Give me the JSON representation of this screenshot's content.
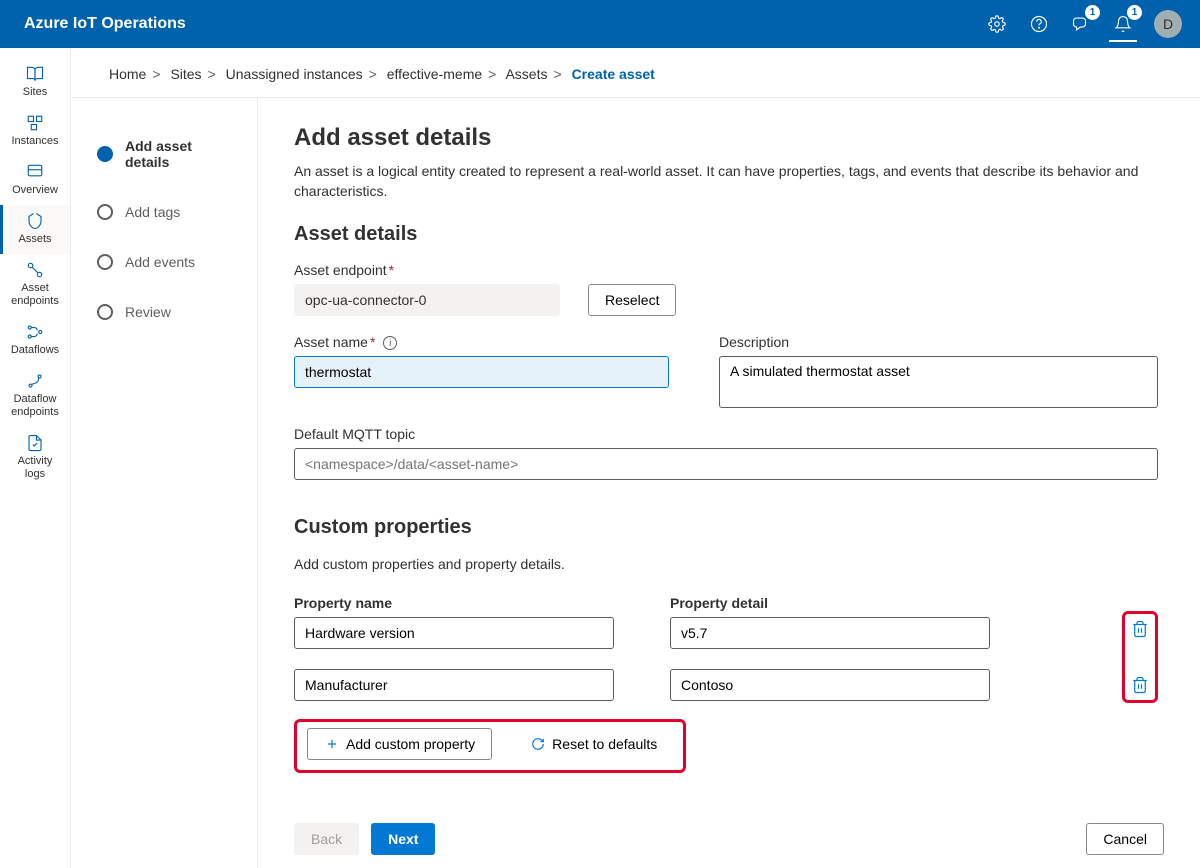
{
  "header": {
    "title": "Azure IoT Operations",
    "badge1": "1",
    "badge2": "1",
    "avatar": "D"
  },
  "sidebar": {
    "items": [
      {
        "label": "Sites"
      },
      {
        "label": "Instances"
      },
      {
        "label": "Overview"
      },
      {
        "label": "Assets"
      },
      {
        "label": "Asset endpoints"
      },
      {
        "label": "Dataflows"
      },
      {
        "label": "Dataflow endpoints"
      },
      {
        "label": "Activity logs"
      }
    ]
  },
  "breadcrumb": {
    "items": [
      "Home",
      "Sites",
      "Unassigned instances",
      "effective-meme",
      "Assets"
    ],
    "current": "Create asset"
  },
  "steps": [
    {
      "label": "Add asset details",
      "state": "current"
    },
    {
      "label": "Add tags",
      "state": "future"
    },
    {
      "label": "Add events",
      "state": "future"
    },
    {
      "label": "Review",
      "state": "future"
    }
  ],
  "form": {
    "title": "Add asset details",
    "desc": "An asset is a logical entity created to represent a real-world asset. It can have properties, tags, and events that describe its behavior and characteristics.",
    "section1": "Asset details",
    "asset_endpoint_label": "Asset endpoint",
    "asset_endpoint_value": "opc-ua-connector-0",
    "reselect": "Reselect",
    "asset_name_label": "Asset name",
    "asset_name_value": "thermostat",
    "description_label": "Description",
    "description_value": "A simulated thermostat asset",
    "mqtt_label": "Default MQTT topic",
    "mqtt_placeholder": "<namespace>/data/<asset-name>",
    "section2": "Custom properties",
    "section2_desc": "Add custom properties and property details.",
    "prop_name_header": "Property name",
    "prop_detail_header": "Property detail",
    "props": [
      {
        "name": "Hardware version",
        "detail": "v5.7"
      },
      {
        "name": "Manufacturer",
        "detail": "Contoso"
      }
    ],
    "add_custom": "Add custom property",
    "reset_defaults": "Reset to defaults"
  },
  "footer": {
    "back": "Back",
    "next": "Next",
    "cancel": "Cancel"
  }
}
